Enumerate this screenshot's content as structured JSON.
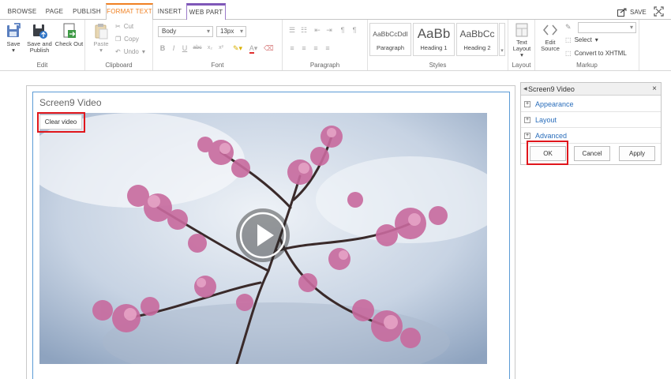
{
  "tabs": [
    {
      "label": "BROWSE"
    },
    {
      "label": "PAGE"
    },
    {
      "label": "PUBLISH"
    },
    {
      "label": "FORMAT TEXT"
    },
    {
      "label": "INSERT"
    },
    {
      "label": "WEB PART"
    }
  ],
  "header_actions": {
    "save_label": "SAVE"
  },
  "ribbon": {
    "edit": {
      "save": "Save",
      "save_publish_1": "Save and",
      "save_publish_2": "Publish",
      "checkout": "Check Out",
      "label": "Edit"
    },
    "clipboard": {
      "paste": "Paste",
      "cut": "Cut",
      "copy": "Copy",
      "undo": "Undo",
      "label": "Clipboard"
    },
    "font": {
      "family": "Body",
      "size": "13px",
      "label": "Font"
    },
    "paragraph": {
      "label": "Paragraph"
    },
    "styles": {
      "items": [
        {
          "preview": "AaBbCcDdI",
          "name": "Paragraph"
        },
        {
          "preview": "AaBb",
          "name": "Heading 1"
        },
        {
          "preview": "AaBbCc",
          "name": "Heading 2"
        }
      ],
      "label": "Styles"
    },
    "layout": {
      "text_layout_1": "Text",
      "text_layout_2": "Layout",
      "label": "Layout"
    },
    "markup": {
      "edit_source_1": "Edit",
      "edit_source_2": "Source",
      "select": "Select",
      "convert": "Convert to XHTML",
      "label": "Markup"
    }
  },
  "webpart": {
    "title": "Screen9 Video",
    "clear_label": "Clear video"
  },
  "toolpane": {
    "title": "Screen9 Video",
    "close": "×",
    "sections": [
      {
        "label": "Appearance"
      },
      {
        "label": "Layout"
      },
      {
        "label": "Advanced"
      }
    ],
    "ok": "OK",
    "cancel": "Cancel",
    "apply": "Apply"
  },
  "colors": {
    "active_tab": "#f08022",
    "contextual_tab": "#7f58b8",
    "highlight": "#e0161c",
    "link": "#2a6ebb"
  }
}
